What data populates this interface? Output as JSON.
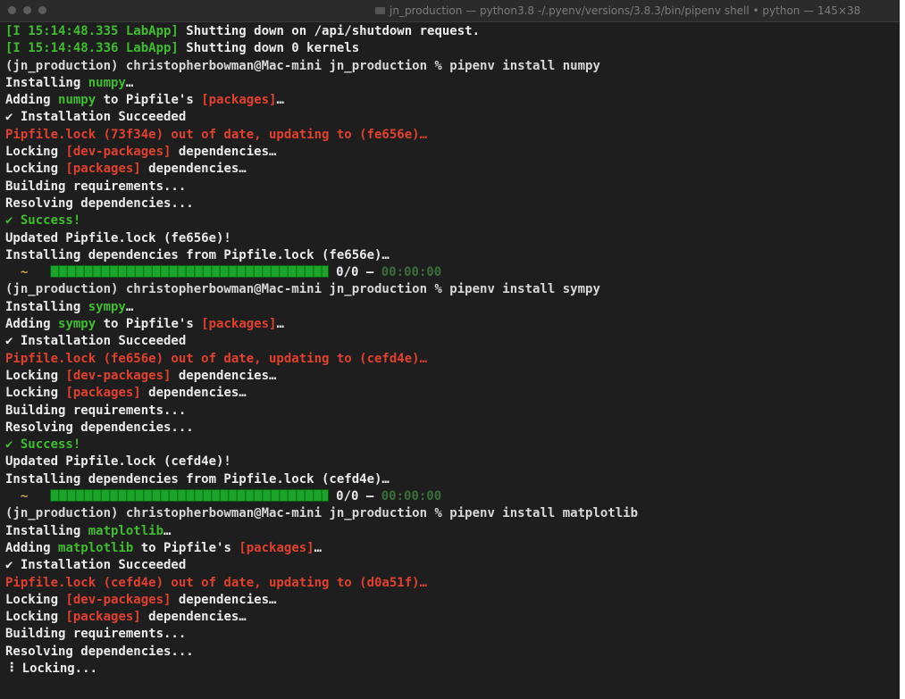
{
  "window": {
    "title": "jn_production — python3.8 -/.pyenv/versions/3.8.3/bin/pipenv shell • python — 145×38"
  },
  "terminal": {
    "lines": [
      {
        "parts": [
          {
            "t": "[I 15:14:48.335 LabApp]",
            "c": "g"
          },
          {
            "t": " Shutting down on /api/shutdown request.",
            "c": ""
          }
        ]
      },
      {
        "parts": [
          {
            "t": "[I 15:14:48.336 LabApp]",
            "c": "g"
          },
          {
            "t": " Shutting down 0 kernels",
            "c": ""
          }
        ]
      },
      {
        "parts": [
          {
            "t": "(jn_production) christopherbowman@Mac-mini jn_production % pipenv install numpy",
            "c": "prompt"
          }
        ]
      },
      {
        "parts": [
          {
            "t": "Installing ",
            "c": ""
          },
          {
            "t": "numpy",
            "c": "g"
          },
          {
            "t": "…",
            "c": ""
          }
        ]
      },
      {
        "parts": [
          {
            "t": "Adding ",
            "c": ""
          },
          {
            "t": "numpy",
            "c": "g"
          },
          {
            "t": " to Pipfile's ",
            "c": ""
          },
          {
            "t": "[packages]",
            "c": "r"
          },
          {
            "t": "…",
            "c": ""
          }
        ]
      },
      {
        "parts": [
          {
            "t": "✔ Installation Succeeded",
            "c": ""
          }
        ]
      },
      {
        "parts": [
          {
            "t": "Pipfile.lock (73f34e) out of date, updating to (fe656e)…",
            "c": "r"
          }
        ]
      },
      {
        "parts": [
          {
            "t": "Locking ",
            "c": ""
          },
          {
            "t": "[dev-packages]",
            "c": "r"
          },
          {
            "t": " dependencies…",
            "c": ""
          }
        ]
      },
      {
        "parts": [
          {
            "t": "Locking ",
            "c": ""
          },
          {
            "t": "[packages]",
            "c": "r"
          },
          {
            "t": " dependencies…",
            "c": ""
          }
        ]
      },
      {
        "parts": [
          {
            "t": "Building requirements...",
            "c": ""
          }
        ]
      },
      {
        "parts": [
          {
            "t": "Resolving dependencies...",
            "c": ""
          }
        ]
      },
      {
        "parts": [
          {
            "t": "✔ Success!",
            "c": "g"
          }
        ]
      },
      {
        "parts": [
          {
            "t": "Updated Pipfile.lock (fe656e)!",
            "c": ""
          }
        ]
      },
      {
        "parts": [
          {
            "t": "Installing dependencies from Pipfile.lock (fe656e)…",
            "c": ""
          }
        ]
      },
      {
        "progress": true,
        "count": "0/0",
        "sep": " — ",
        "time": "00:00:00"
      },
      {
        "parts": [
          {
            "t": "(jn_production) christopherbowman@Mac-mini jn_production % pipenv install sympy",
            "c": "prompt"
          }
        ]
      },
      {
        "parts": [
          {
            "t": "Installing ",
            "c": ""
          },
          {
            "t": "sympy",
            "c": "g"
          },
          {
            "t": "…",
            "c": ""
          }
        ]
      },
      {
        "parts": [
          {
            "t": "Adding ",
            "c": ""
          },
          {
            "t": "sympy",
            "c": "g"
          },
          {
            "t": " to Pipfile's ",
            "c": ""
          },
          {
            "t": "[packages]",
            "c": "r"
          },
          {
            "t": "…",
            "c": ""
          }
        ]
      },
      {
        "parts": [
          {
            "t": "✔ Installation Succeeded",
            "c": ""
          }
        ]
      },
      {
        "parts": [
          {
            "t": "Pipfile.lock (fe656e) out of date, updating to (cefd4e)…",
            "c": "r"
          }
        ]
      },
      {
        "parts": [
          {
            "t": "Locking ",
            "c": ""
          },
          {
            "t": "[dev-packages]",
            "c": "r"
          },
          {
            "t": " dependencies…",
            "c": ""
          }
        ]
      },
      {
        "parts": [
          {
            "t": "Locking ",
            "c": ""
          },
          {
            "t": "[packages]",
            "c": "r"
          },
          {
            "t": " dependencies…",
            "c": ""
          }
        ]
      },
      {
        "parts": [
          {
            "t": "Building requirements...",
            "c": ""
          }
        ]
      },
      {
        "parts": [
          {
            "t": "Resolving dependencies...",
            "c": ""
          }
        ]
      },
      {
        "parts": [
          {
            "t": "✔ Success!",
            "c": "g"
          }
        ]
      },
      {
        "parts": [
          {
            "t": "Updated Pipfile.lock (cefd4e)!",
            "c": ""
          }
        ]
      },
      {
        "parts": [
          {
            "t": "Installing dependencies from Pipfile.lock (cefd4e)…",
            "c": ""
          }
        ]
      },
      {
        "progress": true,
        "count": "0/0",
        "sep": " — ",
        "time": "00:00:00"
      },
      {
        "parts": [
          {
            "t": "(jn_production) christopherbowman@Mac-mini jn_production % pipenv install matplotlib",
            "c": "prompt"
          }
        ]
      },
      {
        "parts": [
          {
            "t": "Installing ",
            "c": ""
          },
          {
            "t": "matplotlib",
            "c": "g"
          },
          {
            "t": "…",
            "c": ""
          }
        ]
      },
      {
        "parts": [
          {
            "t": "Adding ",
            "c": ""
          },
          {
            "t": "matplotlib",
            "c": "g"
          },
          {
            "t": " to Pipfile's ",
            "c": ""
          },
          {
            "t": "[packages]",
            "c": "r"
          },
          {
            "t": "…",
            "c": ""
          }
        ]
      },
      {
        "parts": [
          {
            "t": "✔ Installation Succeeded",
            "c": ""
          }
        ]
      },
      {
        "parts": [
          {
            "t": "Pipfile.lock (cefd4e) out of date, updating to (d0a51f)…",
            "c": "r"
          }
        ]
      },
      {
        "parts": [
          {
            "t": "Locking ",
            "c": ""
          },
          {
            "t": "[dev-packages]",
            "c": "r"
          },
          {
            "t": " dependencies…",
            "c": ""
          }
        ]
      },
      {
        "parts": [
          {
            "t": "Locking ",
            "c": ""
          },
          {
            "t": "[packages]",
            "c": "r"
          },
          {
            "t": " dependencies…",
            "c": ""
          }
        ]
      },
      {
        "parts": [
          {
            "t": "Building requirements...",
            "c": ""
          }
        ]
      },
      {
        "parts": [
          {
            "t": "Resolving dependencies...",
            "c": ""
          }
        ]
      },
      {
        "parts": [
          {
            "t": "⠸ Locking...",
            "c": ""
          }
        ]
      }
    ]
  },
  "colors": {
    "background": "#1e1e1e",
    "green": "#3fbd2f",
    "red": "#e2402f",
    "text": "#ececec"
  }
}
